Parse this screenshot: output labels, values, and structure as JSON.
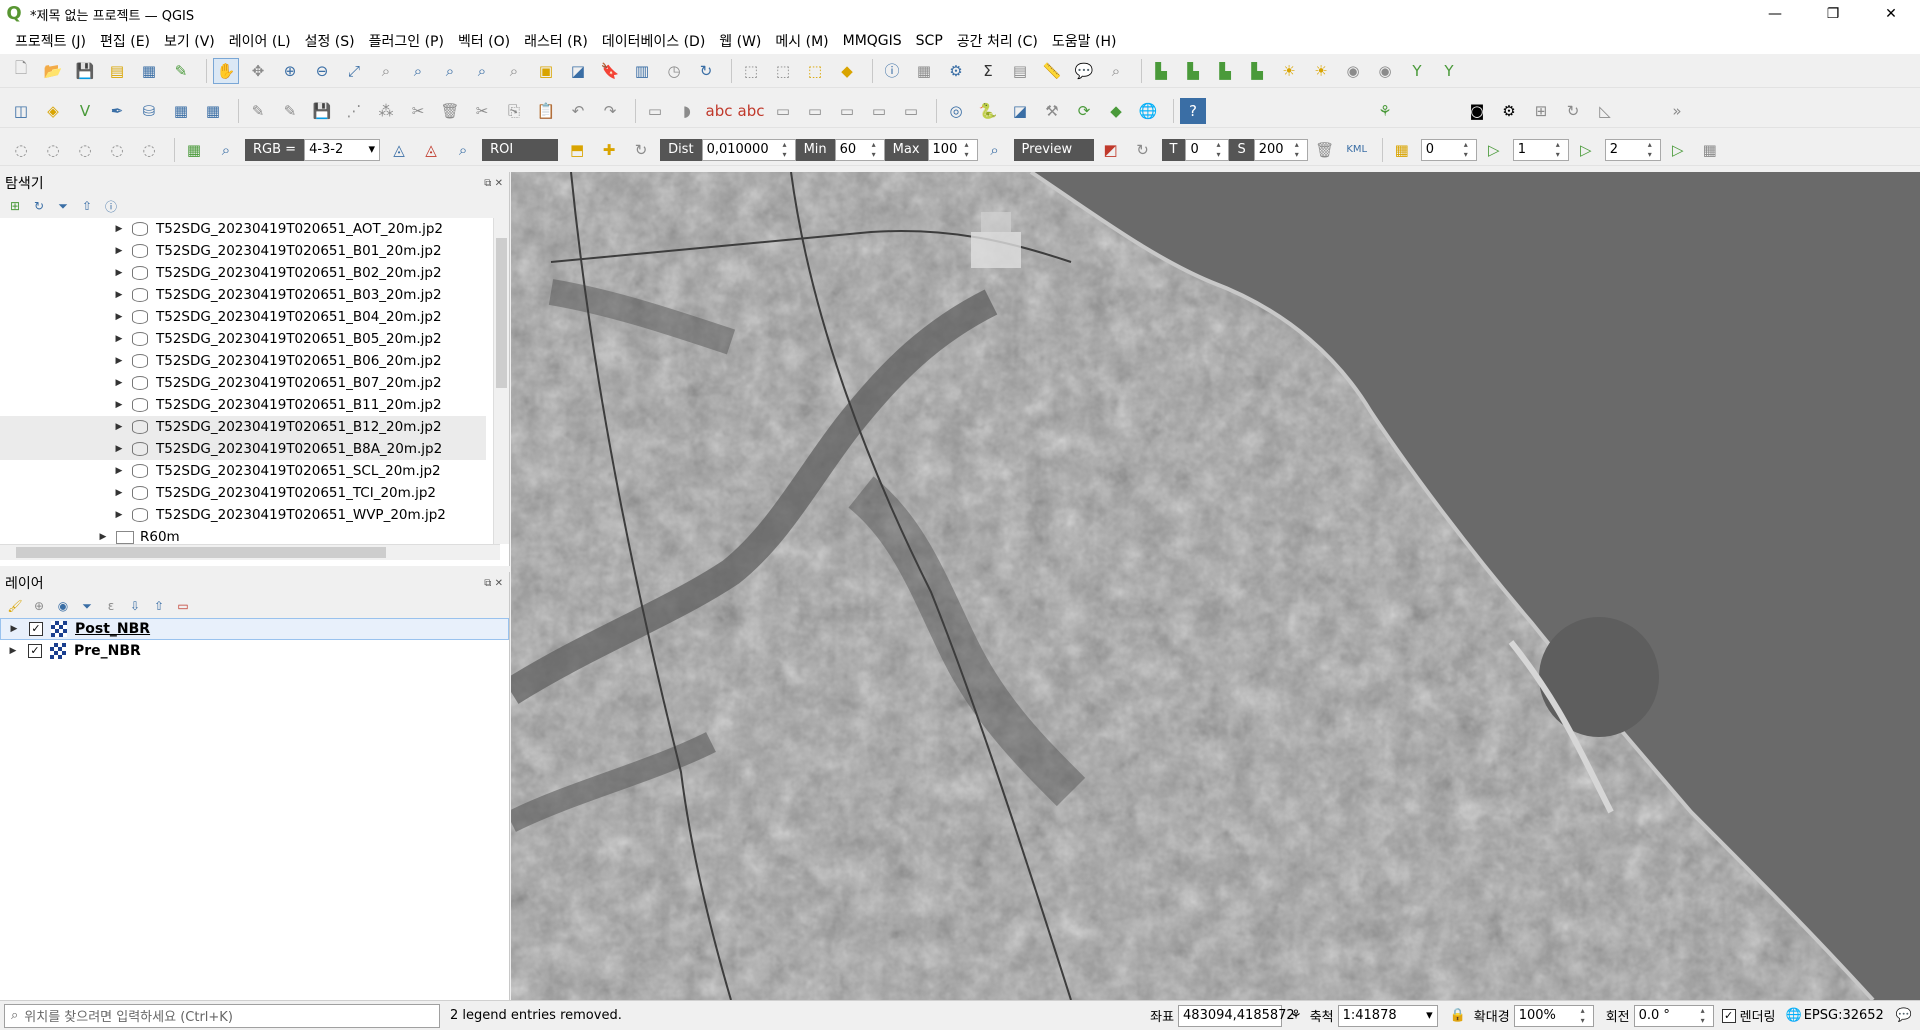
{
  "window": {
    "title": "*제목 없는 프로젝트 — QGIS",
    "minimize": "—",
    "maximize": "❐",
    "close": "✕"
  },
  "menu": [
    "프로젝트 (J)",
    "편집 (E)",
    "보기 (V)",
    "레이어 (L)",
    "설정 (S)",
    "플러그인 (P)",
    "벡터 (O)",
    "래스터 (R)",
    "데이터베이스 (D)",
    "웹 (W)",
    "메시 (M)",
    "MMQGIS",
    "SCP",
    "공간 처리 (C)",
    "도움말 (H)"
  ],
  "scp_toolbar": {
    "rgb_label": "RGB =",
    "rgb_value": "4-3-2",
    "roi_label": "ROI",
    "dist_label": "Dist",
    "dist_value": "0,010000",
    "min_label": "Min",
    "min_value": "60",
    "max_label": "Max",
    "max_value": "100",
    "preview_label": "Preview",
    "t_label": "T",
    "t_value": "0",
    "s_label": "S",
    "s_value": "200",
    "kml_label": "KML",
    "v1": "0",
    "v2": "1",
    "v3": "2"
  },
  "browser": {
    "title": "탐색기",
    "items": [
      "T52SDG_20230419T020651_AOT_20m.jp2",
      "T52SDG_20230419T020651_B01_20m.jp2",
      "T52SDG_20230419T020651_B02_20m.jp2",
      "T52SDG_20230419T020651_B03_20m.jp2",
      "T52SDG_20230419T020651_B04_20m.jp2",
      "T52SDG_20230419T020651_B05_20m.jp2",
      "T52SDG_20230419T020651_B06_20m.jp2",
      "T52SDG_20230419T020651_B07_20m.jp2",
      "T52SDG_20230419T020651_B11_20m.jp2",
      "T52SDG_20230419T020651_B12_20m.jp2",
      "T52SDG_20230419T020651_B8A_20m.jp2",
      "T52SDG_20230419T020651_SCL_20m.jp2",
      "T52SDG_20230419T020651_TCI_20m.jp2",
      "T52SDG_20230419T020651_WVP_20m.jp2"
    ],
    "folder": "R60m"
  },
  "layers": {
    "title": "레이어",
    "items": [
      "Post_NBR",
      "Pre_NBR"
    ]
  },
  "status": {
    "search_placeholder": "위치를 찾으려면 입력하세요 (Ctrl+K)",
    "message": "2 legend entries removed.",
    "coord_label": "좌표",
    "coord_value": "483094,4185872",
    "scale_label": "축척",
    "scale_value": "1:41878",
    "magnify_label": "확대경",
    "magnify_value": "100%",
    "rotation_label": "회전",
    "rotation_value": "0.0 °",
    "render_label": "렌더링",
    "crs": "EPSG:32652"
  }
}
